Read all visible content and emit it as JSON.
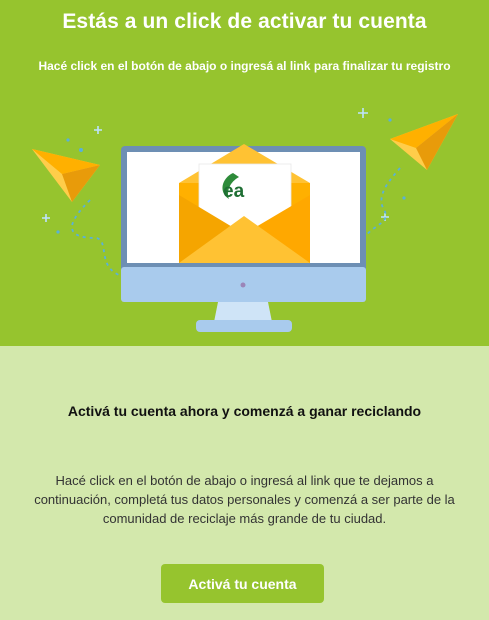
{
  "hero": {
    "title": "Estás a un click de activar tu cuenta",
    "subtitle": "Hacé click en el botón de abajo o ingresá al link  para finalizar tu registro"
  },
  "illustration": {
    "logo_text": "ea",
    "icons": [
      "monitor-icon",
      "envelope-icon",
      "paper-plane-icon"
    ]
  },
  "content": {
    "title": "Activá tu cuenta ahora y comenzá a ganar reciclando",
    "body": "Hacé click en el botón de abajo o ingresá al link que te dejamos a continuación, completá tus datos personales y comenzá a ser parte de la comunidad de reciclaje más grande de tu ciudad."
  },
  "cta": {
    "label": "Activá tu cuenta"
  },
  "colors": {
    "brand_green": "#96c42e",
    "light_green": "#d3e8ac",
    "envelope": "#ffb000"
  }
}
